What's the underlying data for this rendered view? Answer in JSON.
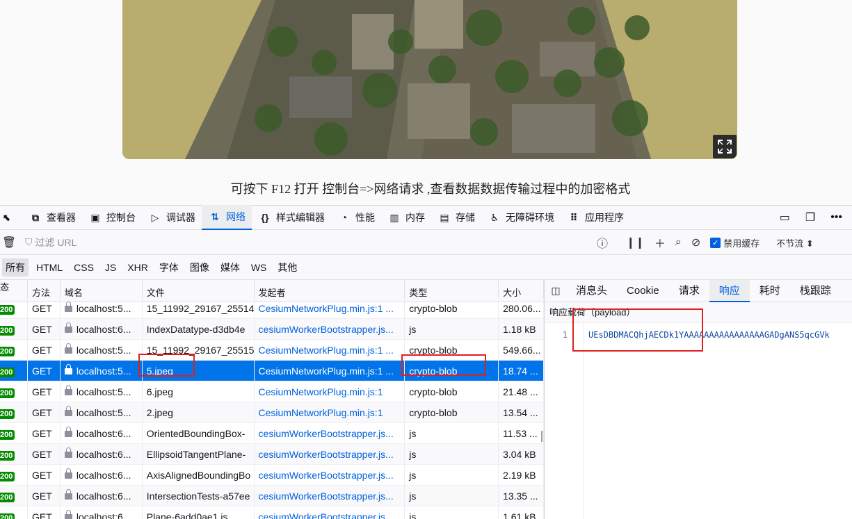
{
  "caption": "可按下 F12 打开 控制台=>网络请求 ,查看数据数据传输过程中的加密格式",
  "toolbar": {
    "tabs": [
      {
        "label": "查看器",
        "icon": "inspector-icon"
      },
      {
        "label": "控制台",
        "icon": "console-icon"
      },
      {
        "label": "调试器",
        "icon": "debugger-icon"
      },
      {
        "label": "网络",
        "icon": "network-icon"
      },
      {
        "label": "样式编辑器",
        "icon": "style-editor-icon"
      },
      {
        "label": "性能",
        "icon": "performance-icon"
      },
      {
        "label": "内存",
        "icon": "memory-icon"
      },
      {
        "label": "存储",
        "icon": "storage-icon"
      },
      {
        "label": "无障碍环境",
        "icon": "accessibility-icon"
      },
      {
        "label": "应用程序",
        "icon": "application-icon"
      }
    ],
    "active_tab": "网络"
  },
  "filter": {
    "placeholder": "过滤 URL",
    "disable_cache_label": "禁用缓存",
    "throttle_label": "不节流"
  },
  "type_filters": [
    "所有",
    "HTML",
    "CSS",
    "JS",
    "XHR",
    "字体",
    "图像",
    "媒体",
    "WS",
    "其他"
  ],
  "columns": [
    "状态",
    "方法",
    "域名",
    "文件",
    "发起者",
    "类型",
    "大小"
  ],
  "rows": [
    {
      "status": "200",
      "method": "GET",
      "domain": "localhost:5...",
      "file": "15_11992_29167_25514",
      "initiator": "CesiumNetworkPlug.min.js:1 ...",
      "type": "crypto-blob",
      "size": "280.06..."
    },
    {
      "status": "200",
      "method": "GET",
      "domain": "localhost:6...",
      "file": "IndexDatatype-d3db4e",
      "initiator": "cesiumWorkerBootstrapper.js...",
      "type": "js",
      "size": "1.18 kB"
    },
    {
      "status": "200",
      "method": "GET",
      "domain": "localhost:5...",
      "file": "15_11992_29167_25515",
      "initiator": "CesiumNetworkPlug.min.js:1 ...",
      "type": "crypto-blob",
      "size": "549.66..."
    },
    {
      "status": "200",
      "method": "GET",
      "domain": "localhost:5...",
      "file": "5.jpeg",
      "initiator": "CesiumNetworkPlug.min.js:1 ...",
      "type": "crypto-blob",
      "size": "18.74 ..."
    },
    {
      "status": "200",
      "method": "GET",
      "domain": "localhost:5...",
      "file": "6.jpeg",
      "initiator": "CesiumNetworkPlug.min.js:1",
      "type": "crypto-blob",
      "size": "21.48 ..."
    },
    {
      "status": "200",
      "method": "GET",
      "domain": "localhost:5...",
      "file": "2.jpeg",
      "initiator": "CesiumNetworkPlug.min.js:1",
      "type": "crypto-blob",
      "size": "13.54 ..."
    },
    {
      "status": "200",
      "method": "GET",
      "domain": "localhost:6...",
      "file": "OrientedBoundingBox-",
      "initiator": "cesiumWorkerBootstrapper.js...",
      "type": "js",
      "size": "11.53 ..."
    },
    {
      "status": "200",
      "method": "GET",
      "domain": "localhost:6...",
      "file": "EllipsoidTangentPlane-",
      "initiator": "cesiumWorkerBootstrapper.js...",
      "type": "js",
      "size": "3.04 kB"
    },
    {
      "status": "200",
      "method": "GET",
      "domain": "localhost:6...",
      "file": "AxisAlignedBoundingBo",
      "initiator": "cesiumWorkerBootstrapper.js...",
      "type": "js",
      "size": "2.19 kB"
    },
    {
      "status": "200",
      "method": "GET",
      "domain": "localhost:6...",
      "file": "IntersectionTests-a57ee",
      "initiator": "cesiumWorkerBootstrapper.js...",
      "type": "js",
      "size": "13.35 ..."
    },
    {
      "status": "200",
      "method": "GET",
      "domain": "localhost:6...",
      "file": "Plane-6add0ae1.js",
      "initiator": "cesiumWorkerBootstrapper.js...",
      "type": "js",
      "size": "1.61 kB"
    }
  ],
  "selected_row": 3,
  "response": {
    "tabs": [
      "消息头",
      "Cookie",
      "请求",
      "响应",
      "耗时",
      "栈跟踪"
    ],
    "active_tab": "响应",
    "payload_title": "响应载荷（payload）",
    "line_number": "1",
    "line_content": "UEsDBDMACQhjAECDk1YAAAAAAAAAAAAAAAAGADgANS5qcGVk"
  },
  "colors": {
    "accent": "#0060df",
    "selected_row": "#0074e8",
    "status_ok": "#058b00",
    "highlight": "#e02020"
  }
}
